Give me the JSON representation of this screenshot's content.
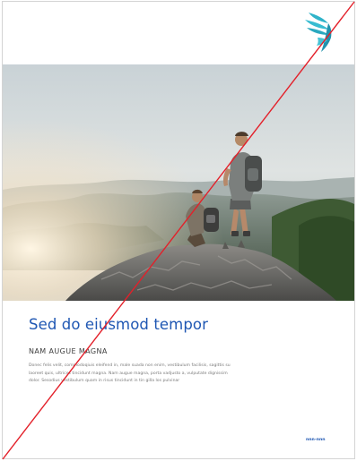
{
  "document": {
    "title": "Sed do eiusmod tempor",
    "subtitle": "NAM AUGUE MAGNA",
    "body": "Donec felis velit, commodoqiuis eleifend in, male suada non enim, vestibulum facilisis, sagittis su laoreet quis, ultrices tincidunt magna. Nam augue magna, porta vadjusto a, vulputate dignissim dolor. Sesodius vestibulum quam in risus tincidunt in tin gilla los pulvinar",
    "footer_code": "nnn-nnn"
  },
  "colors": {
    "accent": "#1f57b3",
    "logo": "#2fb3c9",
    "strike_line": "#e3202a"
  },
  "icons": {
    "logo": "bird-wings-logo-icon"
  }
}
